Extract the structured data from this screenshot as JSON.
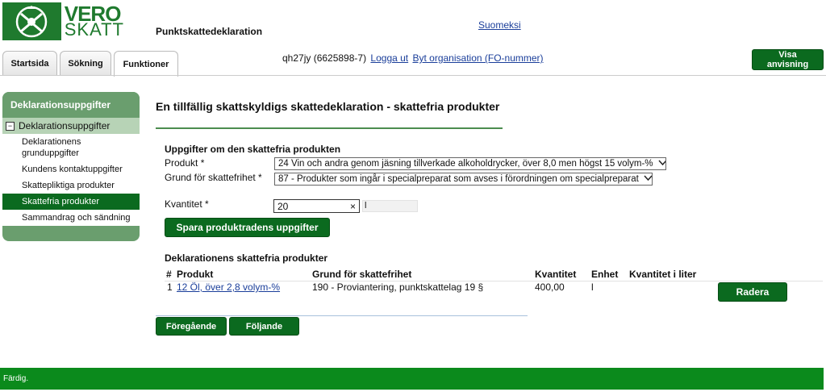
{
  "header": {
    "logo_line1": "VERO",
    "logo_line2": "SKATT",
    "app_title": "Punktskattedeklaration",
    "language_link": "Suomeksi",
    "user_id": "qh27jy (6625898-7)",
    "logout_link": "Logga ut",
    "change_org_link": "Byt organisation (FO-nummer)",
    "help_button": "Visa anvisning"
  },
  "tabs": [
    {
      "label": "Startsida"
    },
    {
      "label": "Sökning"
    },
    {
      "label": "Funktioner"
    }
  ],
  "sidebar": {
    "title": "Deklarationsuppgifter",
    "group": "Deklarationsuppgifter",
    "group_toggle": "−",
    "items": [
      {
        "label": "Deklarationens grunduppgifter"
      },
      {
        "label": "Kundens kontaktuppgifter"
      },
      {
        "label": "Skattepliktiga produkter"
      },
      {
        "label": "Skattefria produkter"
      },
      {
        "label": "Sammandrag och sändning"
      }
    ]
  },
  "main": {
    "heading": "En tillfällig skattskyldigs skattedeklaration - skattefria produkter",
    "section_title": "Uppgifter om den skattefria produkten",
    "product_label": "Produkt *",
    "product_value": "24 Vin och andra genom jäsning tillverkade alkoholdrycker, över 8,0 men högst 15 volym-%",
    "reason_label": "Grund för skattefrihet *",
    "reason_value": "87 - Produkter som ingår i specialpreparat som avses i förordningen om specialpreparat",
    "quantity_label": "Kvantitet *",
    "quantity_value": "20",
    "quantity_clear": "×",
    "unit_value": "l",
    "save_button": "Spara produktradens uppgifter",
    "list_title": "Deklarationens skattefria produkter",
    "table": {
      "headers": [
        "#",
        "Produkt",
        "Grund för skattefrihet",
        "Kvantitet",
        "Enhet",
        "Kvantitet i liter"
      ],
      "rows": [
        {
          "num": "1",
          "product": "12 Öl, över 2,8 volym-%",
          "reason": "190 - Proviantering, punktskattelag 19 §",
          "quantity": "400,00",
          "unit": "l",
          "liters": ""
        }
      ]
    },
    "delete_button": "Radera",
    "prev_button": "Föregående",
    "next_button": "Följande"
  },
  "footer": {
    "status": "Färdig."
  },
  "colors": {
    "brand_green": "#0b6a1f",
    "footer_green": "#0b8a1c",
    "sidebar_green": "#6a9e6e",
    "sidebar_light": "#b7d3b6",
    "link_blue": "#1a3e9a"
  }
}
